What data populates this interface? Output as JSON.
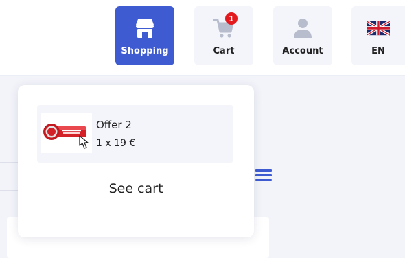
{
  "header": {
    "nav": [
      {
        "id": "shopping",
        "label": "Shopping",
        "icon": "store-icon",
        "active": true
      },
      {
        "id": "cart",
        "label": "Cart",
        "icon": "cart-icon",
        "badge": "1"
      },
      {
        "id": "account",
        "label": "Account",
        "icon": "user-icon"
      },
      {
        "id": "lang",
        "label": "EN",
        "icon": "uk-flag-icon"
      }
    ]
  },
  "cart_dropdown": {
    "items": [
      {
        "name": "Offer 2",
        "quantity_price": "1 x 19 €",
        "thumbnail": "buy-now-button-image"
      }
    ],
    "see_cart_label": "See cart"
  },
  "colors": {
    "accent": "#3f5bd1",
    "badge": "#e3191e",
    "button_bg": "#f4f5fb",
    "page_bg": "#f3f4fa"
  }
}
